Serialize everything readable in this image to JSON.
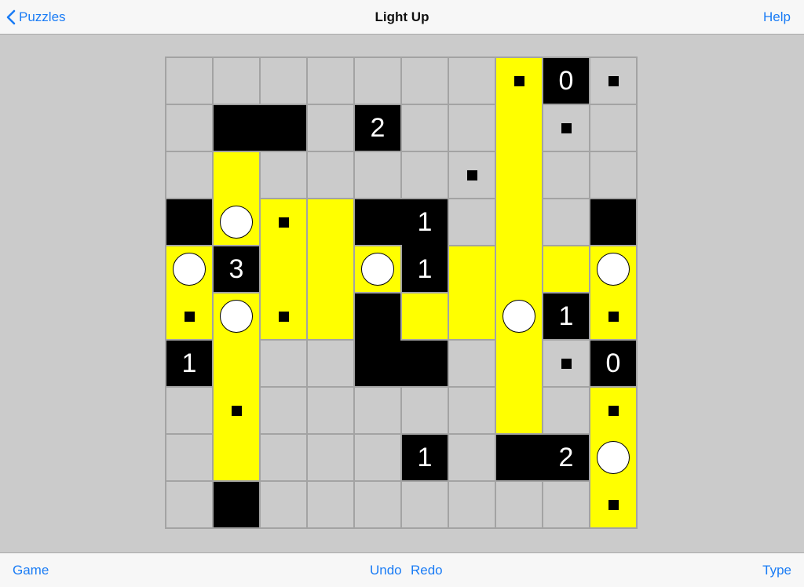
{
  "nav": {
    "back_label": "Puzzles",
    "title": "Light Up",
    "help_label": "Help"
  },
  "toolbar": {
    "game_label": "Game",
    "undo_label": "Undo",
    "redo_label": "Redo",
    "type_label": "Type"
  },
  "colors": {
    "accent": "#1a7cf5",
    "lit": "#ffff00",
    "unlit": "#cbcbcb",
    "wall": "#000000"
  },
  "legend": {
    "E": "empty unlit cell",
    "L": "lit cell",
    "B": "placed light bulb (lit)",
    "m": "no-light mark on unlit cell",
    "ml": "no-light mark on lit cell",
    "W": "black wall without number",
    "0-4": "numbered black wall"
  },
  "board": {
    "size": 10,
    "grid": [
      [
        "E",
        "E",
        "E",
        "E",
        "E",
        "E",
        "E",
        "ml",
        "0",
        "m"
      ],
      [
        "E",
        "W",
        "W",
        "E",
        "2",
        "E",
        "E",
        "L",
        "m",
        "E"
      ],
      [
        "E",
        "L",
        "E",
        "E",
        "E",
        "E",
        "m",
        "L",
        "E",
        "E"
      ],
      [
        "W",
        "B",
        "ml",
        "L",
        "W",
        "1",
        "E",
        "L",
        "E",
        "W"
      ],
      [
        "B",
        "3",
        "L",
        "L",
        "B",
        "1",
        "L",
        "L",
        "L",
        "B"
      ],
      [
        "ml",
        "B",
        "ml",
        "L",
        "W",
        "L",
        "L",
        "B",
        "1",
        "ml"
      ],
      [
        "1",
        "L",
        "E",
        "E",
        "W",
        "W",
        "E",
        "L",
        "m",
        "0"
      ],
      [
        "E",
        "ml",
        "E",
        "E",
        "E",
        "E",
        "E",
        "L",
        "E",
        "ml"
      ],
      [
        "E",
        "L",
        "E",
        "E",
        "E",
        "1",
        "E",
        "W",
        "2",
        "B"
      ],
      [
        "E",
        "W",
        "E",
        "E",
        "E",
        "E",
        "E",
        "E",
        "E",
        "ml"
      ]
    ]
  }
}
